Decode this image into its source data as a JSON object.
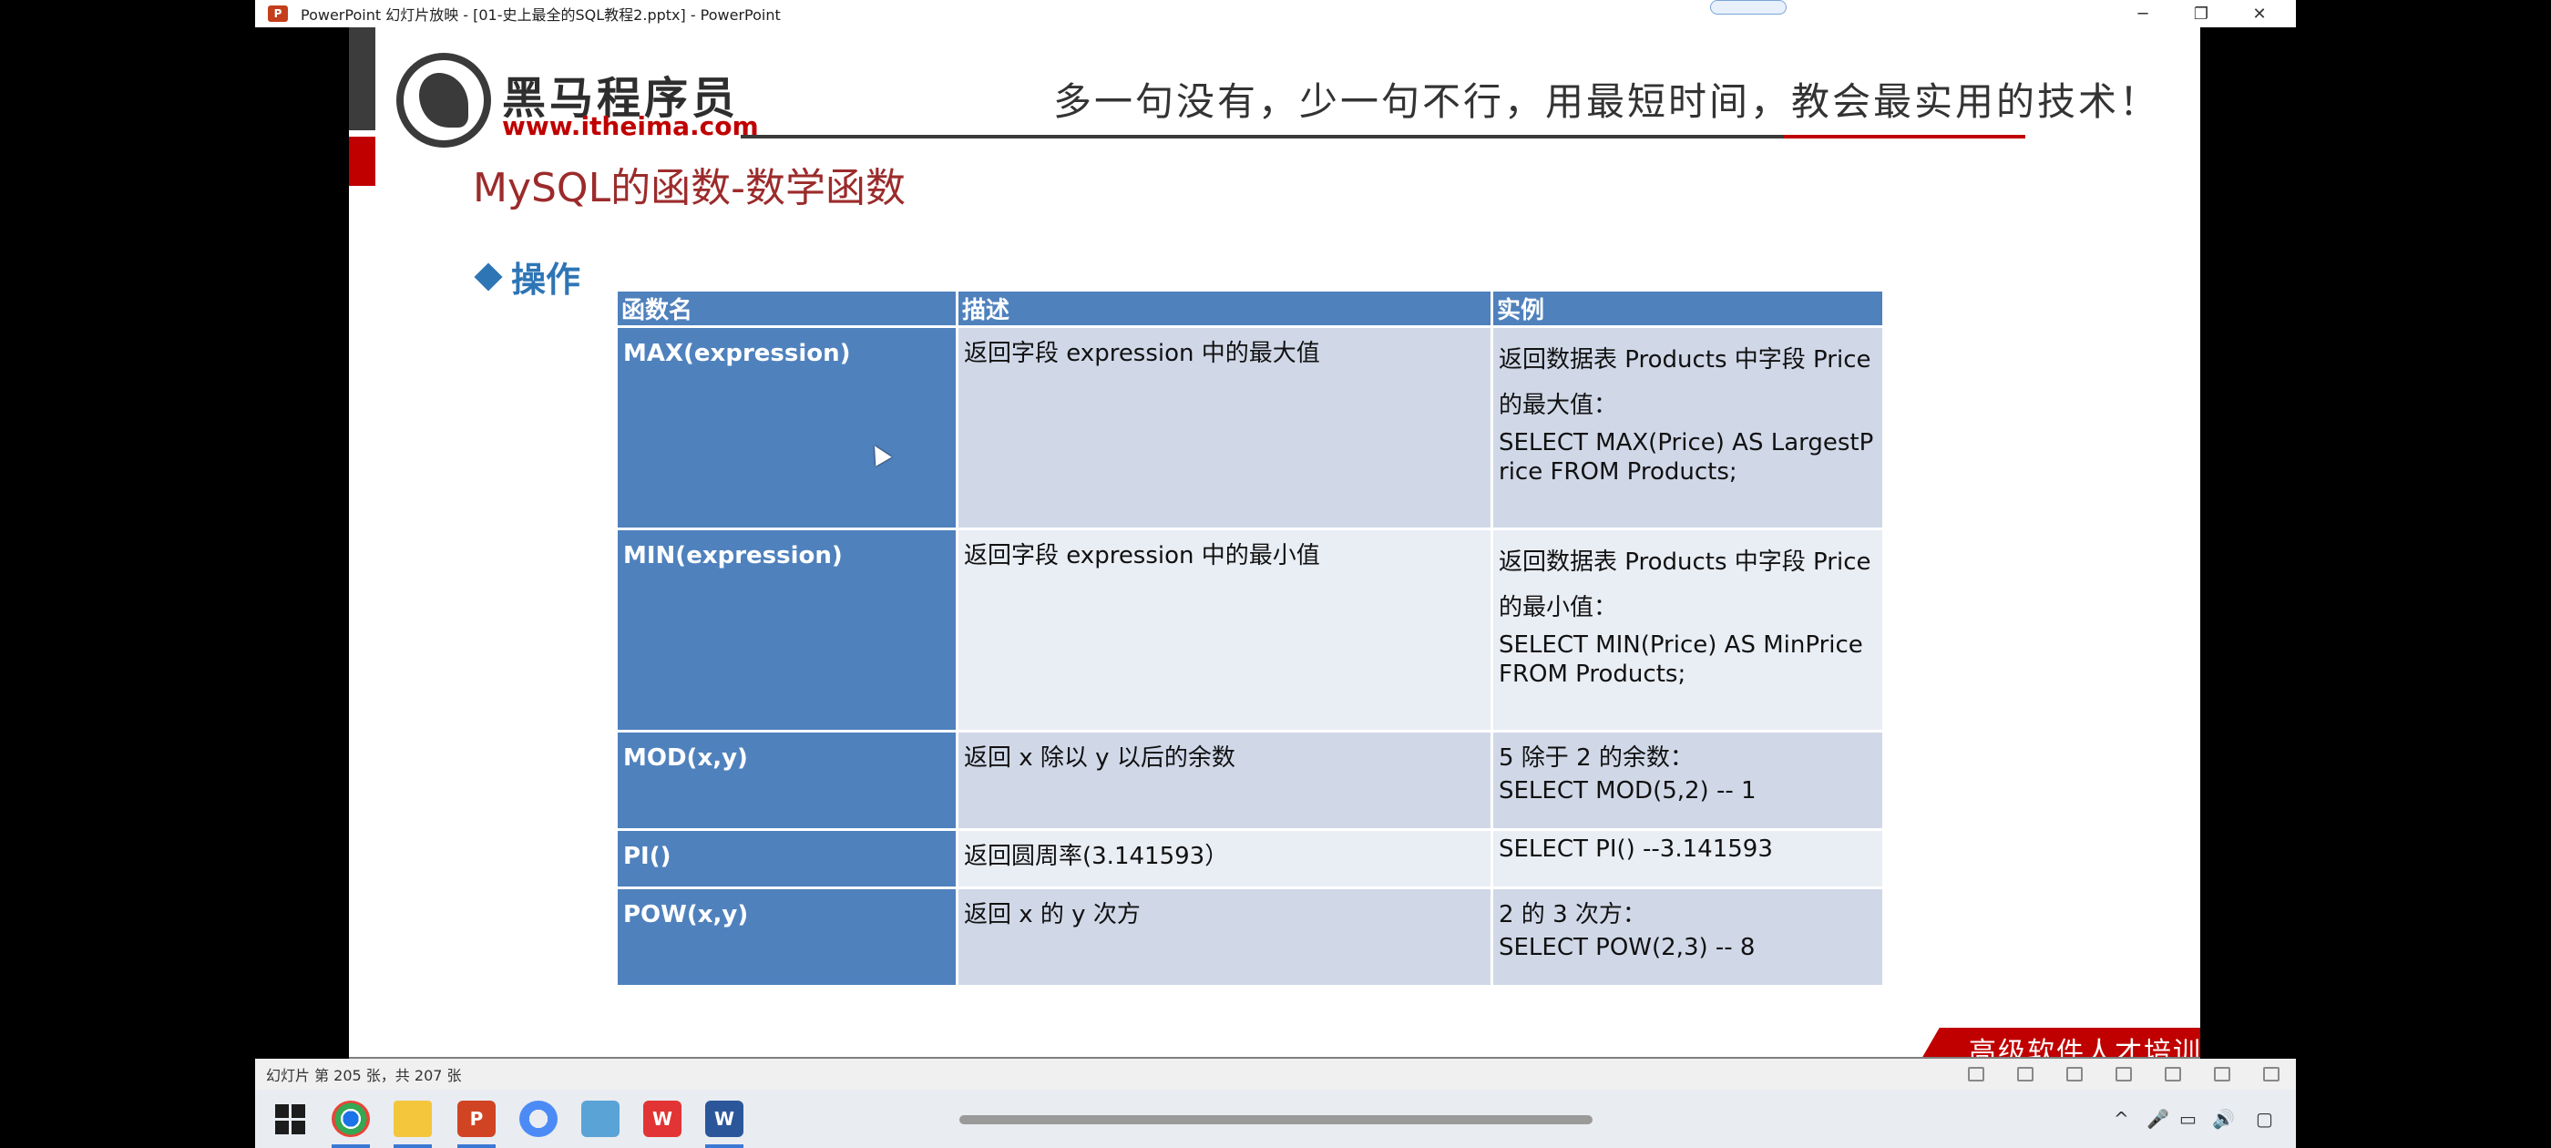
{
  "window": {
    "app_icon": "P",
    "title": "PowerPoint 幻灯片放映 - [01-史上最全的SQL教程2.pptx] - PowerPoint",
    "minimize_glyph": "─",
    "maximize_glyph": "❐",
    "close_glyph": "✕"
  },
  "slide": {
    "logo_name": "黑马程序员",
    "logo_url": "www.itheima.com",
    "slogan": "多一句没有，少一句不行，用最短时间，教会最实用的技术！",
    "title": "MySQL的函数-数学函数",
    "section_label": "操作",
    "banner_text": "高级软件人才培训专家",
    "table": {
      "headers": [
        "函数名",
        "描述",
        "实例"
      ],
      "rows": [
        {
          "name": "MAX(expression)",
          "desc": "返回字段 expression 中的最大值",
          "ex_line1": "返回数据表 Products 中字段 Price",
          "ex_line2": "的最大值：",
          "ex_code": "SELECT MAX(Price) AS LargestPrice FROM Products;"
        },
        {
          "name": "MIN(expression)",
          "desc": "返回字段 expression 中的最小值",
          "ex_line1": "返回数据表 Products 中字段 Price",
          "ex_line2": "的最小值：",
          "ex_code": "SELECT MIN(Price) AS MinPrice FROM Products;"
        },
        {
          "name": "MOD(x,y)",
          "desc": "返回 x 除以 y 以后的余数",
          "ex_line1": "5 除于 2 的余数：",
          "ex_code": "SELECT MOD(5,2) -- 1"
        },
        {
          "name": "PI()",
          "desc": "返回圆周率(3.141593）",
          "ex_code": "SELECT PI() --3.141593"
        },
        {
          "name": "POW(x,y)",
          "desc": "返回 x 的 y 次方",
          "ex_line1": "2 的 3 次方：",
          "ex_code": "SELECT POW(2,3) -- 8"
        }
      ]
    }
  },
  "statusbar": {
    "slide_counter": "幻灯片 第 205 张，共 207 张"
  },
  "taskbar": {
    "icons": [
      "start-icon",
      "chrome-icon",
      "explorer-icon",
      "powerpoint-icon",
      "drive-icon",
      "app-icon",
      "wps-icon",
      "word-icon"
    ],
    "wps_label": "W",
    "word_label": "W",
    "ppt_label": "P",
    "tray_up": "^",
    "tray_mic": "🎤",
    "tray_net": "▭",
    "tray_vol": "🔊",
    "tray_msg": "▢"
  }
}
